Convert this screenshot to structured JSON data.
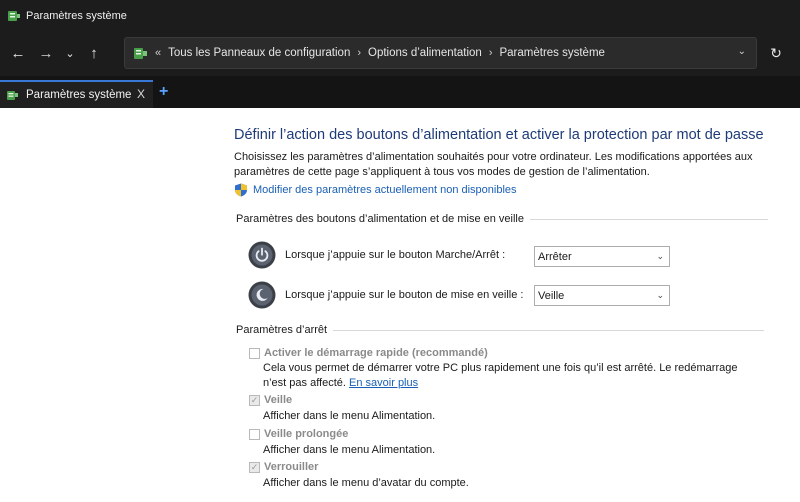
{
  "window": {
    "title": "Paramètres système",
    "app_icon": "power-options-icon"
  },
  "nav": {
    "back_icon": "arrow-left-icon",
    "forward_icon": "arrow-right-icon",
    "history_icon": "chevron-down-icon",
    "up_icon": "arrow-up-icon",
    "refresh_icon": "refresh-icon"
  },
  "address": {
    "prefix": "«",
    "crumbs": [
      "Tous les Panneaux de configuration",
      "Options d’alimentation",
      "Paramètres système"
    ]
  },
  "tabs": [
    {
      "label": "Paramètres système",
      "close": "X"
    }
  ],
  "newtab": "+",
  "main": {
    "heading": "Définir l’action des boutons d’alimentation et activer la protection par mot de passe",
    "desc": "Choisissez les paramètres d’alimentation souhaités pour votre ordinateur. Les modifications apportées aux paramètres de cette page s’appliquent à tous vos modes de gestion de l’alimentation.",
    "change_link": "Modifier des paramètres actuellement non disponibles",
    "section1": "Paramètres des boutons d’alimentation et de mise en veille",
    "power_label": "Lorsque j’appuie sur le bouton Marche/Arrêt :",
    "power_value": "Arrêter",
    "sleep_label": "Lorsque j’appuie sur le bouton de mise en veille :",
    "sleep_value": "Veille",
    "section2": "Paramètres d’arrêt",
    "options": [
      {
        "label": "Activer le démarrage rapide (recommandé)",
        "checked": false,
        "desc": "Cela vous permet de démarrer votre PC plus rapidement une fois qu’il est arrêté. Le redémarrage n’est pas affecté.",
        "link": "En savoir plus"
      },
      {
        "label": "Veille",
        "checked": true,
        "desc": "Afficher dans le menu Alimentation."
      },
      {
        "label": "Veille prolongée",
        "checked": false,
        "desc": "Afficher dans le menu Alimentation."
      },
      {
        "label": "Verrouiller",
        "checked": true,
        "desc": "Afficher dans le menu d’avatar du compte."
      }
    ]
  },
  "colors": {
    "accent": "#3a78d6",
    "link": "#1a5fb4",
    "heading": "#1e3b78",
    "titlebar": "#1c1c1c"
  }
}
